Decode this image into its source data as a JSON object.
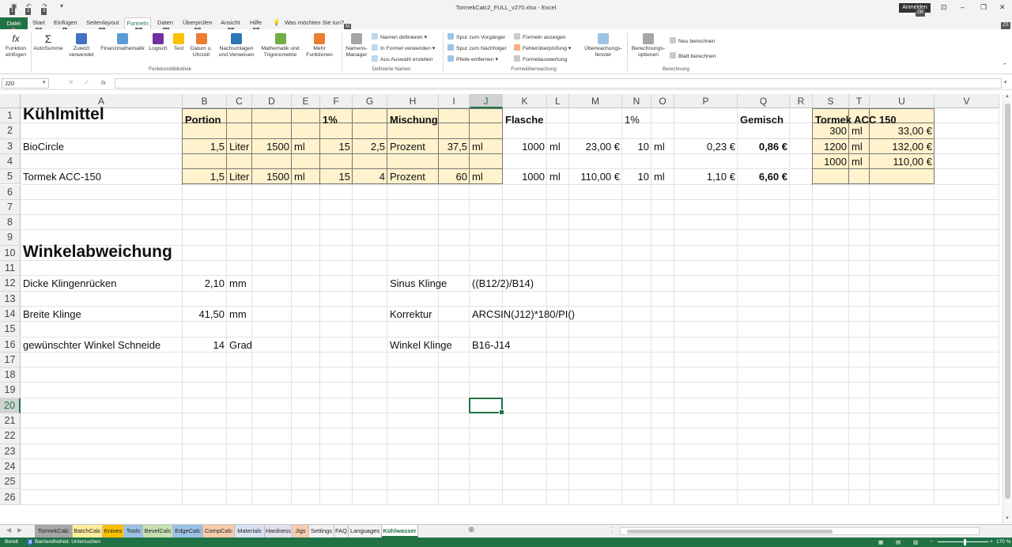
{
  "window": {
    "title": "TormekCalc2_FULL_v270.xlsx - Excel",
    "signin": "Anmelden",
    "signin_keytip": "ZR",
    "ribbon_keytip": "ZS"
  },
  "qat_keytips": [
    "1",
    "2",
    "3"
  ],
  "ribbon_tabs": [
    {
      "label": "Datei",
      "keytip": "D"
    },
    {
      "label": "Start",
      "keytip": "R"
    },
    {
      "label": "Einfügen",
      "keytip": "I"
    },
    {
      "label": "Seitenlayout",
      "keytip": "S"
    },
    {
      "label": "Formeln",
      "keytip": "O"
    },
    {
      "label": "Daten",
      "keytip": "V"
    },
    {
      "label": "Überprüfen",
      "keytip": "P"
    },
    {
      "label": "Ansicht",
      "keytip": "F"
    },
    {
      "label": "Hilfe",
      "keytip": "B"
    }
  ],
  "tellme": {
    "label": "Was möchten Sie tun?",
    "keytip": "M"
  },
  "ribbon": {
    "btn_funktion": "Funktion\neinfügen",
    "btn_autosumme": "AutoSumme",
    "btn_zuletzt": "Zuletzt\nverwendet",
    "btn_finanz": "Finanzmathematik",
    "btn_logisch": "Logisch",
    "btn_text": "Text",
    "btn_datum": "Datum u.\nUhrzeit",
    "btn_nachschlagen": "Nachschlagen\nund Verweisen",
    "btn_mathe": "Mathematik und\nTrigonometrie",
    "btn_mehr": "Mehr\nFunktionen",
    "btn_namensmanager": "Namens-\nManager",
    "names_define": "Namen definieren",
    "names_use": "In Formel verwenden",
    "names_create": "Aus Auswahl erstellen",
    "audit_precedents": "Spur zum Vorgänger",
    "audit_dependents": "Spur zum Nachfolger",
    "audit_remove": "Pfeile entfernen",
    "audit_show": "Formeln anzeigen",
    "audit_error": "Fehlerüberprüfung",
    "audit_eval": "Formelauswertung",
    "btn_watch": "Überwachungs-\nfenster",
    "btn_calcopts": "Berechnungs-\noptionen",
    "calc_now": "Neu berechnen",
    "calc_sheet": "Blatt berechnen",
    "grp_funktionsbibliothek": "Funktionsbibliothek",
    "grp_namen": "Definierte Namen",
    "grp_formel": "Formelüberwachung",
    "grp_berechnung": "Berechnung"
  },
  "formula_bar": {
    "namebox": "J20",
    "fx": "fx",
    "content": ""
  },
  "columns": [
    "A",
    "B",
    "C",
    "D",
    "E",
    "F",
    "G",
    "H",
    "I",
    "J",
    "K",
    "L",
    "M",
    "N",
    "O",
    "P",
    "Q",
    "R",
    "S",
    "T",
    "U",
    "V"
  ],
  "selected_column": "J",
  "rows": [
    "1",
    "2",
    "3",
    "4",
    "5",
    "6",
    "7",
    "8",
    "9",
    "10",
    "11",
    "12",
    "13",
    "14",
    "15",
    "16",
    "17",
    "18",
    "19",
    "20",
    "21",
    "22",
    "23",
    "24",
    "25",
    "26"
  ],
  "selected_row": "20",
  "cells": {
    "A1": "Kühlmittel",
    "B1": "Portion",
    "F1": "1%",
    "H1": "Mischung",
    "K1": "Flasche",
    "N1": "1%",
    "Q1": "Gemisch",
    "S1": "Tormek ACC 150",
    "S2": "300",
    "T2": "ml",
    "U2": "33,00 €",
    "A3": "BioCircle",
    "B3": "1,5",
    "C3": "Liter",
    "D3": "1500",
    "E3": "ml",
    "F3": "15",
    "G3": "2,5",
    "H3": "Prozent",
    "I3": "37,5",
    "J3": "ml",
    "K3": "1000",
    "L3": "ml",
    "M3": "23,00 €",
    "N3": "10",
    "O3": "ml",
    "P3": "0,23 €",
    "Q3": "0,86 €",
    "S3": "1200",
    "T3": "ml",
    "U3": "132,00 €",
    "S4": "1000",
    "T4": "ml",
    "U4": "110,00 €",
    "A5": "Tormek ACC-150",
    "B5": "1,5",
    "C5": "Liter",
    "D5": "1500",
    "E5": "ml",
    "F5": "15",
    "G5": "4",
    "H5": "Prozent",
    "I5": "60",
    "J5": "ml",
    "K5": "1000",
    "L5": "ml",
    "M5": "110,00 €",
    "N5": "10",
    "O5": "ml",
    "P5": "1,10 €",
    "Q5": "6,60 €",
    "A10": "Winkelabweichung",
    "A12": "Dicke Klingenrücken",
    "B12": "2,10",
    "C12": "mm",
    "H12": "Sinus Klinge",
    "J12": "((B12/2)/B14)",
    "A14": "Breite Klinge",
    "B14": "41,50",
    "C14": "mm",
    "H14": "Korrektur",
    "J14": "ARCSIN(J12)*180/PI()",
    "A16": "gewünschter Winkel Schneide",
    "B16": "14",
    "C16": "Grad",
    "H16": "Winkel Klinge",
    "J16": "B16-J14"
  },
  "sheet_tabs": [
    {
      "label": "TormekCalc",
      "color": "#a6a6a6"
    },
    {
      "label": "BatchCalc",
      "color": "#ffeb9c"
    },
    {
      "label": "Knives",
      "color": "#ffc000"
    },
    {
      "label": "Tools",
      "color": "#9bc2e6"
    },
    {
      "label": "BevelCalc",
      "color": "#c6e0b4"
    },
    {
      "label": "EdgeCalc",
      "color": "#9bc2e6"
    },
    {
      "label": "CompCalc",
      "color": "#f8cbad"
    },
    {
      "label": "Materials",
      "color": "#d9e1f2"
    },
    {
      "label": "Hardness",
      "color": "#e4dfec"
    },
    {
      "label": "Jigs",
      "color": "#f8cbad"
    },
    {
      "label": "Settings",
      "color": ""
    },
    {
      "label": "FAQ",
      "color": ""
    },
    {
      "label": "Languages",
      "color": ""
    },
    {
      "label": "Kühlwasser",
      "color": "",
      "active": true
    }
  ],
  "status": {
    "ready": "Bereit",
    "accessibility": "Barrierefreiheit: Untersuchen",
    "zoom": "170 %"
  },
  "colors": {
    "accent": "#217346",
    "fill": "#fff2cc"
  }
}
